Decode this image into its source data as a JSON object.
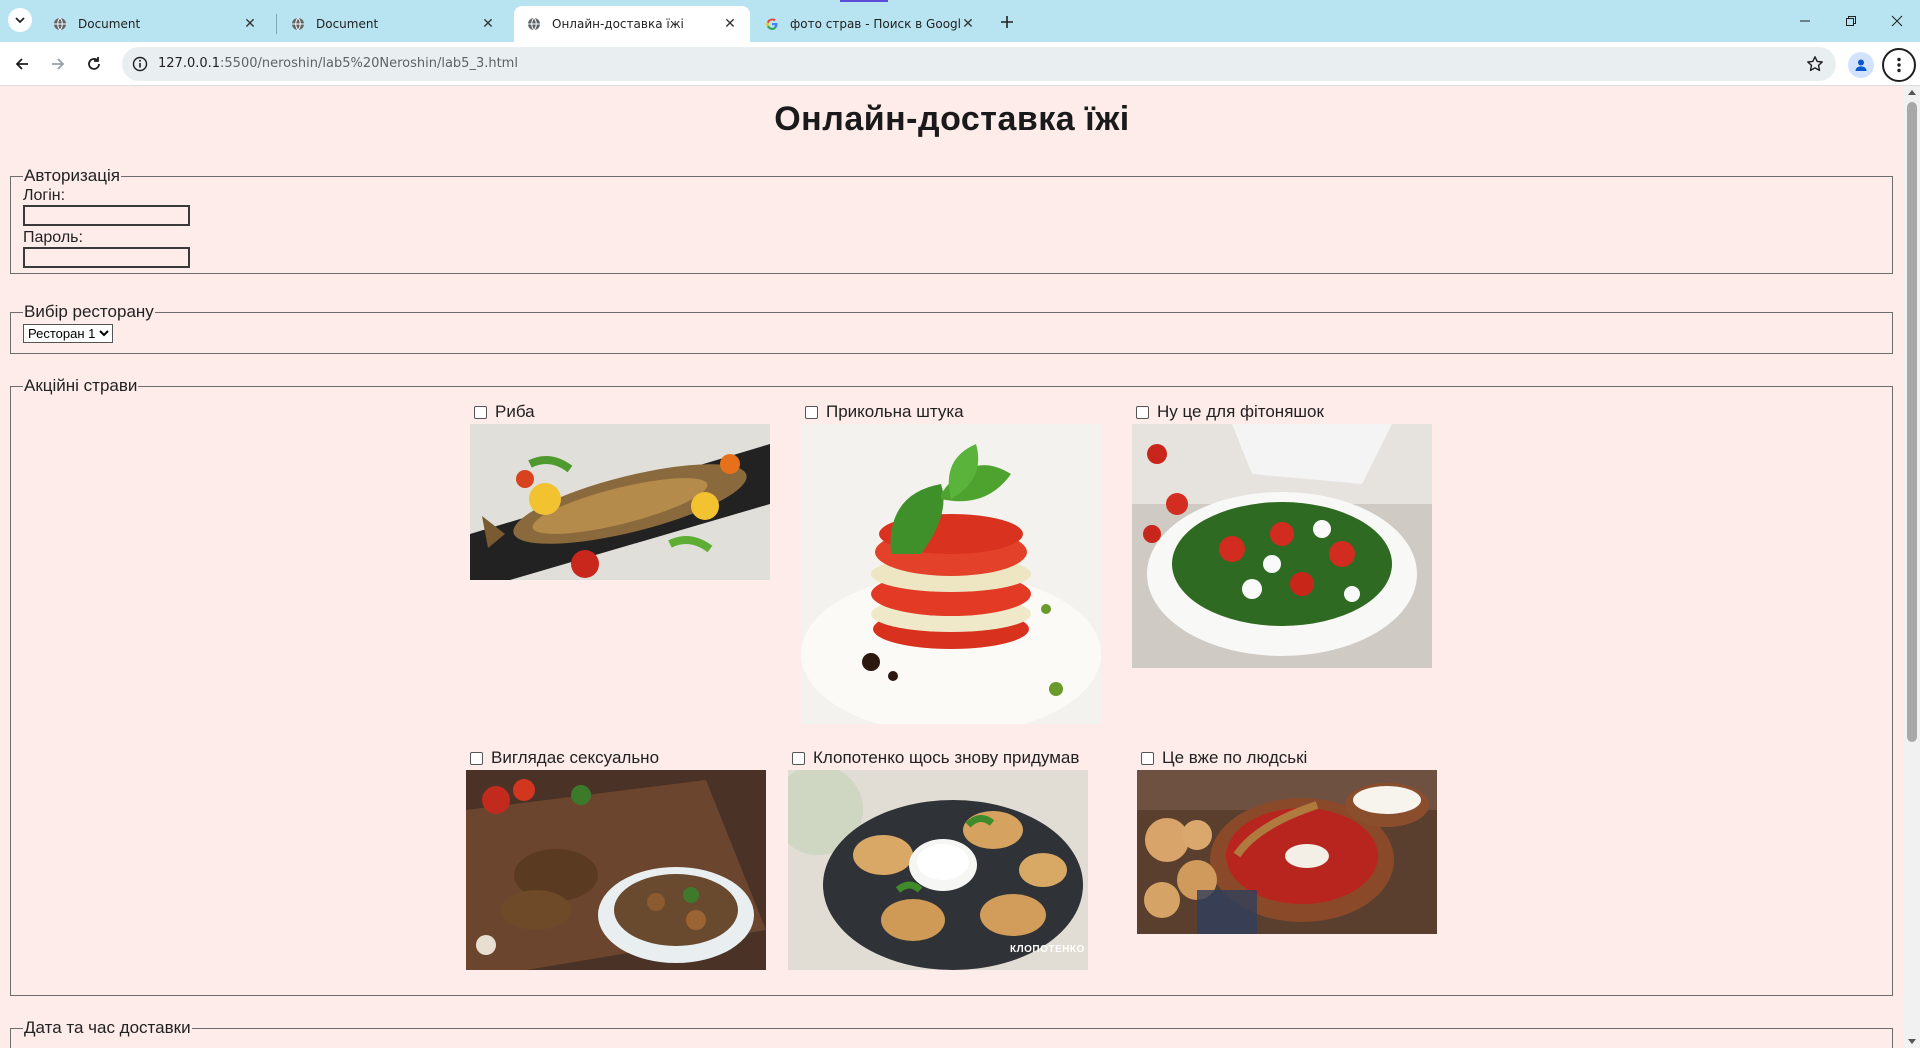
{
  "browser": {
    "tabs": [
      {
        "title": "Document",
        "active": false
      },
      {
        "title": "Document",
        "active": false
      },
      {
        "title": "Онлайн-доставка їжі",
        "active": true
      },
      {
        "title": "фото страв - Поиск в Google",
        "active": false
      }
    ],
    "url_host": "127.0.0.1",
    "url_rest": ":5500/neroshin/lab5%20Neroshin/lab5_3.html"
  },
  "page": {
    "title": "Онлайн-доставка їжі",
    "auth": {
      "legend": "Авторизація",
      "login_label": "Логін:",
      "login_value": "",
      "password_label": "Пароль:",
      "password_value": ""
    },
    "restaurant": {
      "legend": "Вибір ресторану",
      "selected": "Ресторан 1"
    },
    "promo": {
      "legend": "Акційні страви",
      "dishes": [
        {
          "label": "Риба",
          "checked": false,
          "image": "grilled-fish"
        },
        {
          "label": "Прикольна штука",
          "checked": false,
          "image": "caprese-tower"
        },
        {
          "label": "Ну це для фітоняшок",
          "checked": false,
          "image": "salad-bowl"
        },
        {
          "label": "Виглядає сексуально",
          "checked": false,
          "image": "stew-board"
        },
        {
          "label": "Клопотенко щось знову придумав",
          "checked": false,
          "image": "pancakes"
        },
        {
          "label": "Це вже по людські",
          "checked": false,
          "image": "borscht"
        }
      ],
      "watermark": "КЛОПОТЕНКО"
    },
    "delivery": {
      "legend": "Дата та час доставки"
    }
  },
  "colors": {
    "page_bg": "#fdecea",
    "tabbar_bg": "#b8e4f1",
    "border": "#6d6d6d"
  }
}
